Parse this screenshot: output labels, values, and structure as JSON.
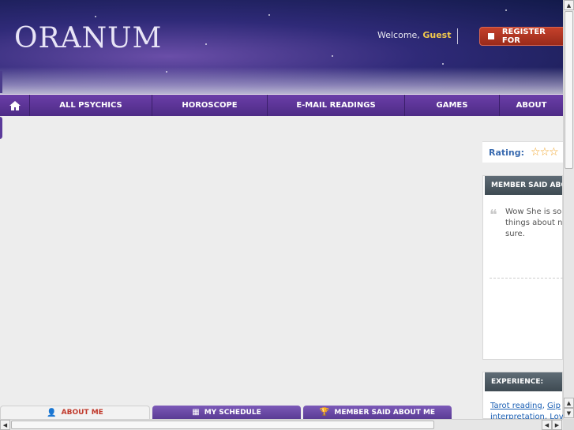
{
  "header": {
    "logo": "ORANUM",
    "welcome_prefix": "Welcome,",
    "welcome_user": "Guest",
    "register_label": "REGISTER FOR"
  },
  "nav": {
    "items": [
      {
        "label": "ALL PSYCHICS"
      },
      {
        "label": "HOROSCOPE"
      },
      {
        "label": "E-MAIL READINGS"
      },
      {
        "label": "GAMES"
      },
      {
        "label": "ABOUT"
      }
    ]
  },
  "sidebar": {
    "rating_label": "Rating:",
    "rating_stars": "☆☆☆",
    "member_said_title": "MEMBER SAID ABO",
    "quote_lines": [
      "Wow She is so",
      "things about n",
      "sure."
    ],
    "experience_title": "EXPERIENCE:",
    "experience_links": [
      "Tarot reading",
      "Gip",
      "interpretation",
      "Lov"
    ]
  },
  "tabs": [
    {
      "label": "ABOUT ME",
      "icon": "person-icon"
    },
    {
      "label": "MY SCHEDULE",
      "icon": "calendar-icon"
    },
    {
      "label": "MEMBER SAID ABOUT ME",
      "icon": "trophy-icon"
    }
  ],
  "colors": {
    "accent": "#5a3b94",
    "register": "#b03420",
    "guest": "#f2c94c"
  }
}
